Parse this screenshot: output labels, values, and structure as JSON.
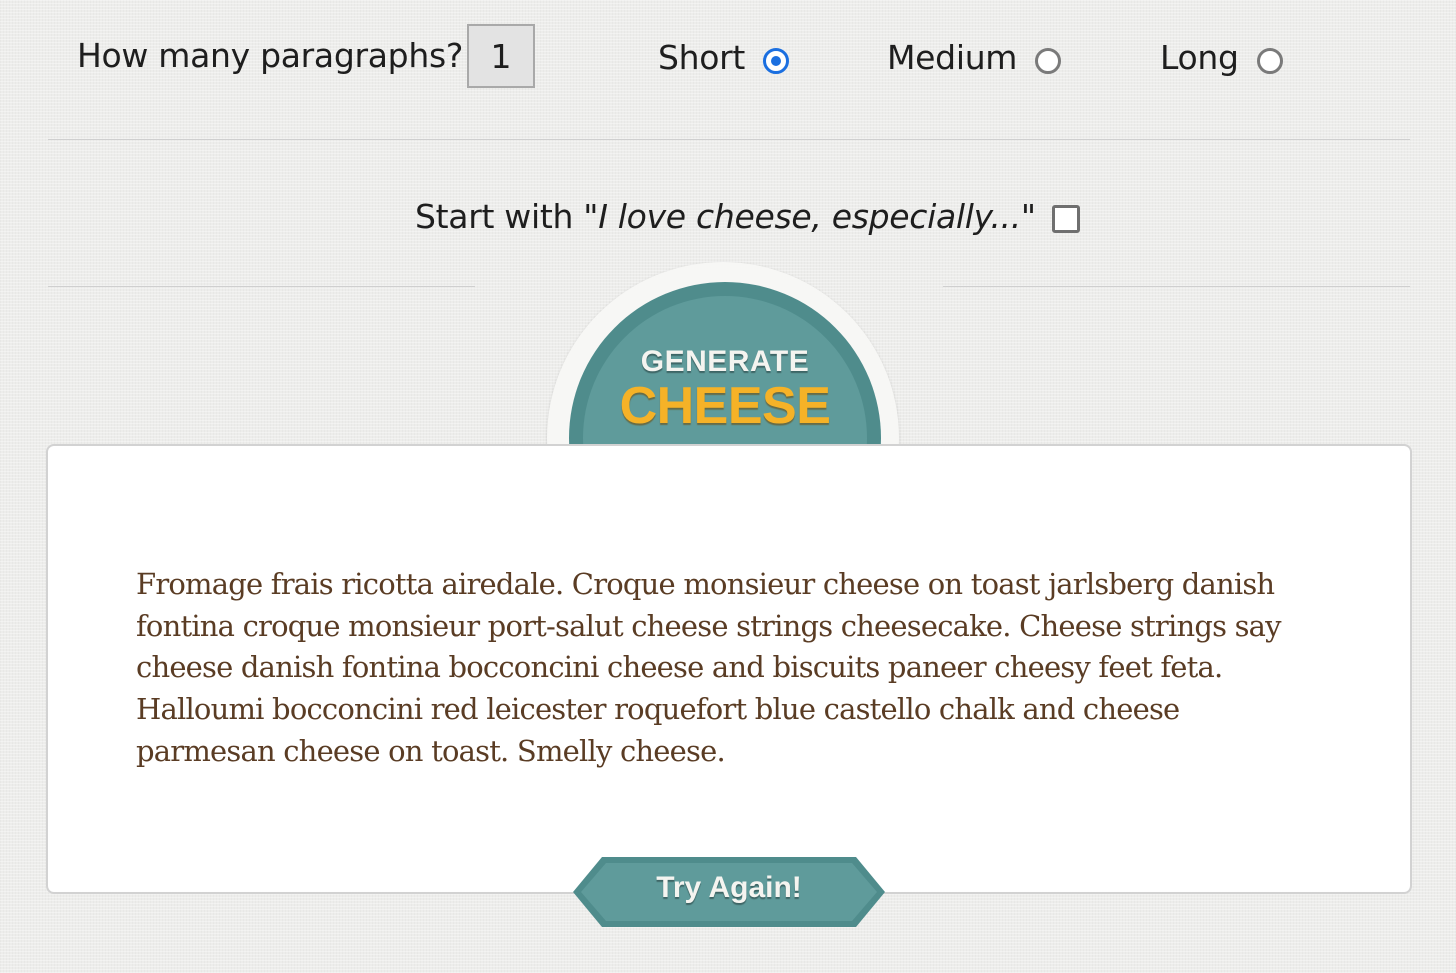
{
  "options": {
    "paragraphs_label": "How many paragraphs?",
    "paragraphs_value": "1",
    "length_options": [
      {
        "label": "Short",
        "selected": true
      },
      {
        "label": "Medium",
        "selected": false
      },
      {
        "label": "Long",
        "selected": false
      }
    ]
  },
  "start_with": {
    "prefix": "Start with \"",
    "phrase": "I love cheese, especially...",
    "suffix": "\"",
    "checked": false
  },
  "generate_button": {
    "line1": "GENERATE",
    "line2": "CHEESE"
  },
  "output": {
    "text": "Fromage frais ricotta airedale. Croque monsieur cheese on toast jarlsberg danish fontina croque monsieur port-salut cheese strings cheesecake. Cheese strings say cheese danish fontina bocconcini cheese and biscuits paneer cheesy feet feta. Halloumi bocconcini red leicester roquefort blue castello chalk and cheese parmesan cheese on toast. Smelly cheese."
  },
  "try_again": {
    "label": "Try Again!"
  },
  "colors": {
    "teal": "#5f9b9b",
    "teal_dark": "#4f8c8c",
    "cheese_yellow": "#f5b227",
    "text_brown": "#5a3c24",
    "radio_blue": "#1b6fe0"
  }
}
